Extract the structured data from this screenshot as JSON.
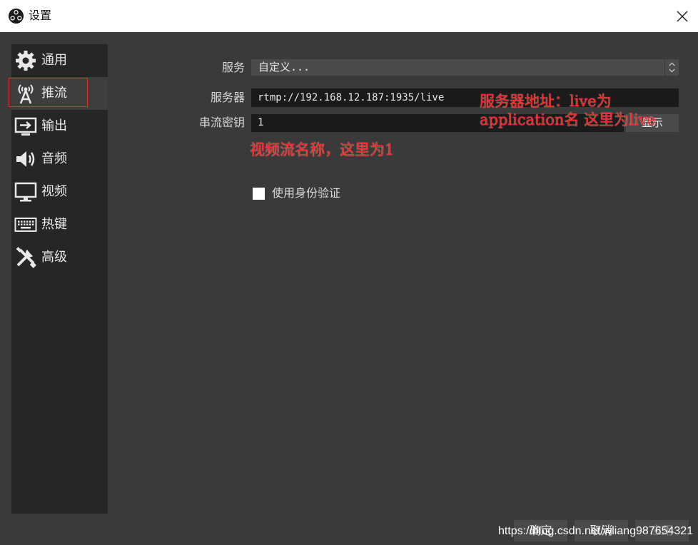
{
  "window": {
    "title": "设置",
    "close_icon": "close-icon"
  },
  "sidebar": {
    "items": [
      {
        "label": "通用",
        "icon": "gear-icon"
      },
      {
        "label": "推流",
        "icon": "broadcast-antenna-icon"
      },
      {
        "label": "输出",
        "icon": "output-icon"
      },
      {
        "label": "音频",
        "icon": "speaker-icon"
      },
      {
        "label": "视频",
        "icon": "monitor-icon"
      },
      {
        "label": "热键",
        "icon": "keyboard-icon"
      },
      {
        "label": "高级",
        "icon": "tools-icon"
      }
    ],
    "active_index": 1
  },
  "stream": {
    "service_label": "服务",
    "service_value": "自定义...",
    "server_label": "服务器",
    "server_value": "rtmp://192.168.12.187:1935/live",
    "key_label": "串流密钥",
    "key_value": "1",
    "show_button": "显示",
    "auth_label": "使用身份验证",
    "auth_checked": false
  },
  "annotations": {
    "server_line1": "服务器地址：live为",
    "server_line2": "application名 这里为live",
    "key_note": "视频流名称，这里为1"
  },
  "footer": {
    "ok": "确定",
    "cancel": "取消",
    "apply": "应用"
  },
  "watermark": "https://blog.csdn.net/wliang987654321",
  "colors": {
    "annotation": "#ff1e1e",
    "highlight_box": "#e0302a"
  }
}
